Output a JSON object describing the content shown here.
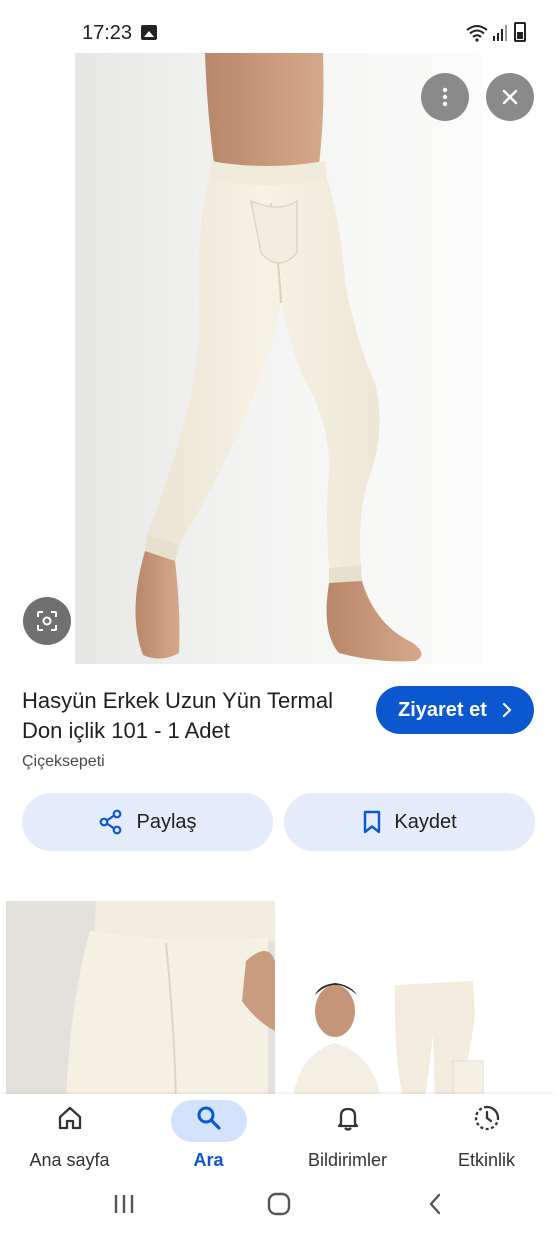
{
  "status_bar": {
    "time": "17:23"
  },
  "product": {
    "title": "Hasyün Erkek Uzun Yün Termal Don içlik 101 - 1 Adet",
    "source": "Çiçeksepeti",
    "visit_label": "Ziyaret et",
    "share_label": "Paylaş",
    "save_label": "Kaydet"
  },
  "bottom_nav": {
    "items": [
      {
        "label": "Ana sayfa",
        "icon": "home-icon"
      },
      {
        "label": "Ara",
        "icon": "search-icon",
        "active": true
      },
      {
        "label": "Bildirimler",
        "icon": "bell-icon"
      },
      {
        "label": "Etkinlik",
        "icon": "activity-icon"
      }
    ]
  },
  "colors": {
    "accent": "#0b57d0",
    "pill_bg": "#e4ebfa",
    "active_nav_bg": "#d3e3fd"
  }
}
